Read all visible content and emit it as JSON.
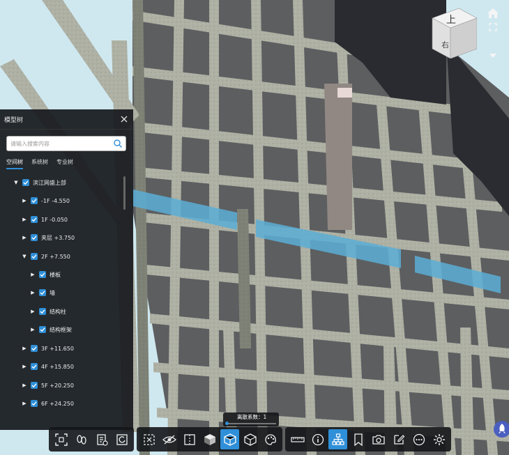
{
  "panel": {
    "title": "模型树",
    "search_placeholder": "请输入搜索内容",
    "tabs": [
      {
        "label": "空间树",
        "active": true
      },
      {
        "label": "系统树",
        "active": false
      },
      {
        "label": "专业树",
        "active": false
      }
    ],
    "tree": [
      {
        "label": "滨江网盛上部",
        "expanded": true,
        "checked": true,
        "level": 0
      },
      {
        "label": "-1F  -4.550",
        "expanded": false,
        "checked": true,
        "level": 1
      },
      {
        "label": "1F  -0.050",
        "expanded": false,
        "checked": true,
        "level": 1
      },
      {
        "label": "夹层  +3.750",
        "expanded": false,
        "checked": true,
        "level": 1
      },
      {
        "label": "2F  +7.550",
        "expanded": true,
        "checked": true,
        "level": 1
      },
      {
        "label": "楼板",
        "expanded": false,
        "checked": true,
        "level": 2
      },
      {
        "label": "墙",
        "expanded": false,
        "checked": true,
        "level": 2
      },
      {
        "label": "结构柱",
        "expanded": false,
        "checked": true,
        "level": 2
      },
      {
        "label": "结构框架",
        "expanded": false,
        "checked": true,
        "level": 2
      },
      {
        "label": "3F  +11.650",
        "expanded": false,
        "checked": true,
        "level": 1
      },
      {
        "label": "4F  +15.850",
        "expanded": false,
        "checked": true,
        "level": 1
      },
      {
        "label": "5F  +20.250",
        "expanded": false,
        "checked": true,
        "level": 1
      },
      {
        "label": "6F  +24.250",
        "expanded": false,
        "checked": true,
        "level": 1
      }
    ]
  },
  "viewcube": {
    "top_face": "上",
    "side_face": "右"
  },
  "scatter": {
    "label": "离散系数：1",
    "value": 0
  },
  "toolbar": {
    "groups": [
      [
        "fit-view-icon",
        "walk-icon",
        "clipboard-icon",
        "reset-icon"
      ],
      [
        "box-select-icon",
        "eye-icon",
        "section-icon",
        "cube-solid-icon",
        "cube-blue-icon",
        "cube-outline-icon",
        "palette-icon"
      ],
      [
        "ruler-icon",
        "info-icon",
        "structure-tree-icon",
        "bookmark-icon",
        "camera-icon",
        "edit-icon",
        "more-icon",
        "settings-icon"
      ]
    ],
    "active": "structure-tree-icon",
    "active2": "cube-blue-icon"
  },
  "colors": {
    "accent": "#2f8fd8",
    "panel_bg": "#16181c",
    "concrete": "#a9ac9f",
    "highlight_beam": "#5aaed6"
  }
}
